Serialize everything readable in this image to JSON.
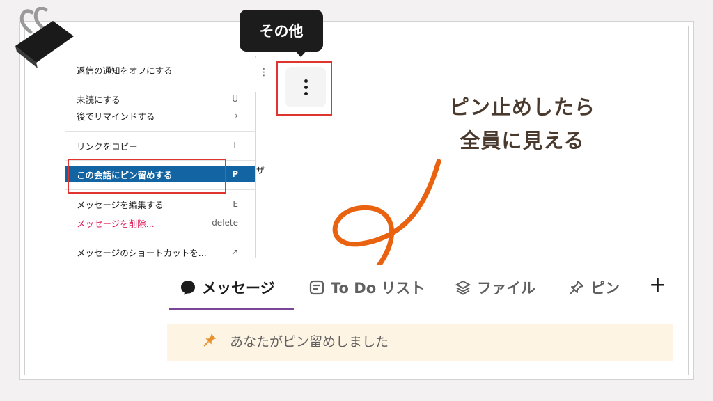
{
  "menu": {
    "items": [
      {
        "label": "返信の通知をオフにする",
        "shortcut": ""
      },
      {
        "label": "未読にする",
        "shortcut": "U"
      },
      {
        "label": "後でリマインドする",
        "shortcut": "›"
      },
      {
        "label": "リンクをコピー",
        "shortcut": "L"
      },
      {
        "label": "この会話にピン留めする",
        "shortcut": "P"
      },
      {
        "label": "メッセージを編集する",
        "shortcut": "E"
      },
      {
        "label": "メッセージを削除...",
        "shortcut": "delete"
      },
      {
        "label": "メッセージのショートカットを...",
        "shortcut": "↗"
      }
    ]
  },
  "tooltip": {
    "label": "その他"
  },
  "partial_text": "ザ",
  "annotation": {
    "line1": "ピン止めしたら",
    "line2": "全員に見える"
  },
  "tabs": [
    {
      "label": "メッセージ",
      "icon": "message-icon"
    },
    {
      "label": "To Do リスト",
      "icon": "todo-icon"
    },
    {
      "label": "ファイル",
      "icon": "files-icon"
    },
    {
      "label": "ピン",
      "icon": "pin-outline-icon"
    }
  ],
  "add_tab": "+",
  "pinned": {
    "text": "あなたがピン留めしました",
    "icon": "pin-icon"
  },
  "colors": {
    "highlight": "#1264a3",
    "danger": "#e01e5a",
    "red_box": "#e0342f",
    "arrow": "#e8620f",
    "tab_active": "#7b4598",
    "pinned_bg": "#fdf4e3",
    "annotation_text": "#4a3a2e"
  }
}
